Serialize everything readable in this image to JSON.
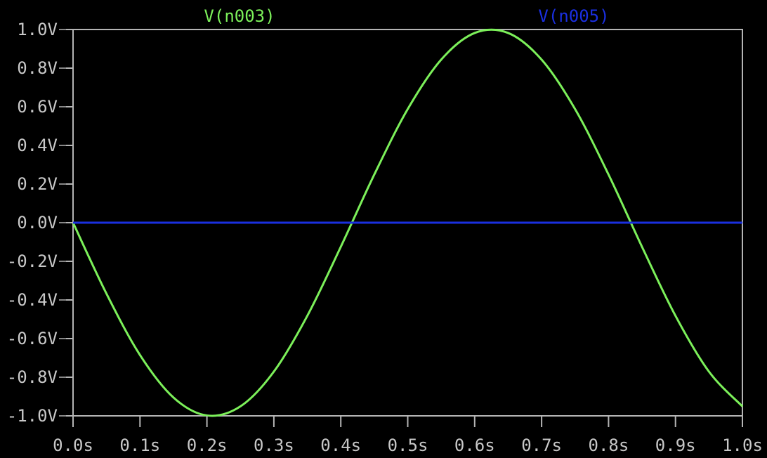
{
  "chart_data": {
    "type": "line",
    "title": "",
    "xlabel": "",
    "ylabel": "",
    "xlim": [
      0.0,
      1.0
    ],
    "ylim": [
      -1.0,
      1.0
    ],
    "grid": false,
    "legend_placement": "top",
    "x_ticks": [
      "0.0s",
      "0.1s",
      "0.2s",
      "0.3s",
      "0.4s",
      "0.5s",
      "0.6s",
      "0.7s",
      "0.8s",
      "0.9s",
      "1.0s"
    ],
    "y_ticks": [
      "1.0V",
      "0.8V",
      "0.6V",
      "0.4V",
      "0.2V",
      "0.0V",
      "-0.2V",
      "-0.4V",
      "-0.6V",
      "-0.8V",
      "-1.0V"
    ],
    "x_tick_values": [
      0.0,
      0.1,
      0.2,
      0.3,
      0.4,
      0.5,
      0.6,
      0.7,
      0.8,
      0.9,
      1.0
    ],
    "y_tick_values": [
      1.0,
      0.8,
      0.6,
      0.4,
      0.2,
      0.0,
      -0.2,
      -0.4,
      -0.6,
      -0.8,
      -1.0
    ],
    "series": [
      {
        "name": "V(n003)",
        "color": "#7cf05a",
        "x": [
          0.0,
          0.05,
          0.1,
          0.15,
          0.2,
          0.25,
          0.3,
          0.35,
          0.4,
          0.45,
          0.5,
          0.55,
          0.6,
          0.65,
          0.7,
          0.75,
          0.8,
          0.85,
          0.9,
          0.95,
          1.0
        ],
        "values": [
          0.0,
          -0.368,
          -0.685,
          -0.905,
          -0.998,
          -0.951,
          -0.771,
          -0.482,
          -0.125,
          0.249,
          0.588,
          0.844,
          0.982,
          0.982,
          0.844,
          0.588,
          0.249,
          -0.125,
          -0.482,
          -0.771,
          -0.951
        ]
      },
      {
        "name": "V(n005)",
        "color": "#1a2fe0",
        "x": [
          0.0,
          1.0
        ],
        "values": [
          0.0,
          0.0
        ]
      }
    ]
  }
}
